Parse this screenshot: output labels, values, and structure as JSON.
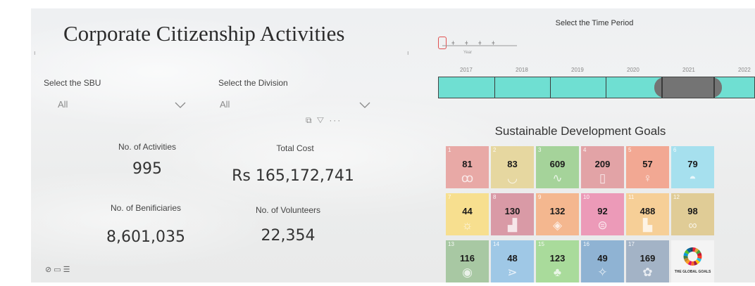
{
  "dashboard": {
    "title": "Corporate Citizenship Activities"
  },
  "slicers": {
    "sbu": {
      "label": "Select the SBU",
      "value": "All"
    },
    "division": {
      "label": "Select the Division",
      "value": "All"
    }
  },
  "kpis": {
    "activities": {
      "label": "No. of Activities",
      "value": "995"
    },
    "cost": {
      "label": "Total Cost",
      "value": "Rs 165,172,741"
    },
    "beneficiaries": {
      "label": "No. of Benificiaries",
      "value": "8,601,035"
    },
    "volunteers": {
      "label": "No. of Volunteers",
      "value": "22,354"
    }
  },
  "visual_toolbar": {
    "icons": [
      "copy-icon",
      "filter-icon",
      "more-options-icon"
    ],
    "text": "⧉ ▽ ···"
  },
  "bottom_icons": [
    "settings-icon",
    "chat-icon",
    "list-icon"
  ],
  "time_slicer": {
    "title": "Select the Time Period",
    "level_caption": "Year",
    "years": [
      "2017",
      "2018",
      "2019",
      "2020",
      "2021",
      "2022"
    ],
    "selected_range": [
      "2021",
      "2021"
    ]
  },
  "sdg": {
    "title": "Sustainable Development Goals",
    "tiles": [
      {
        "goal": "1",
        "value": "81",
        "color": "#e8a9a6",
        "icon": "family-icon"
      },
      {
        "goal": "2",
        "value": "83",
        "color": "#e6d7a0",
        "icon": "bowl-icon"
      },
      {
        "goal": "3",
        "value": "609",
        "color": "#a5d39a",
        "icon": "heartbeat-icon"
      },
      {
        "goal": "4",
        "value": "209",
        "color": "#e2a3a6",
        "icon": "book-icon"
      },
      {
        "goal": "5",
        "value": "57",
        "color": "#f2a893",
        "icon": "gender-icon"
      },
      {
        "goal": "6",
        "value": "79",
        "color": "#a6e0ee",
        "icon": "water-icon"
      },
      {
        "goal": "7",
        "value": "44",
        "color": "#f7df8f",
        "icon": "sun-icon"
      },
      {
        "goal": "8",
        "value": "130",
        "color": "#d99aa6",
        "icon": "growth-icon"
      },
      {
        "goal": "9",
        "value": "132",
        "color": "#f4b78f",
        "icon": "cubes-icon"
      },
      {
        "goal": "10",
        "value": "92",
        "color": "#ec9ab8",
        "icon": "equality-icon"
      },
      {
        "goal": "11",
        "value": "488",
        "color": "#f6cf97",
        "icon": "city-icon"
      },
      {
        "goal": "12",
        "value": "98",
        "color": "#e0cc96",
        "icon": "infinity-icon"
      },
      {
        "goal": "13",
        "value": "116",
        "color": "#a8c8a3",
        "icon": "eye-icon"
      },
      {
        "goal": "14",
        "value": "48",
        "color": "#9fc8e6",
        "icon": "fish-icon"
      },
      {
        "goal": "15",
        "value": "123",
        "color": "#a9db9b",
        "icon": "tree-icon"
      },
      {
        "goal": "16",
        "value": "49",
        "color": "#8fb3d3",
        "icon": "dove-icon"
      },
      {
        "goal": "17",
        "value": "169",
        "color": "#a3b3c6",
        "icon": "partnership-icon"
      }
    ],
    "logo_text": "THE GLOBAL GOALS"
  }
}
